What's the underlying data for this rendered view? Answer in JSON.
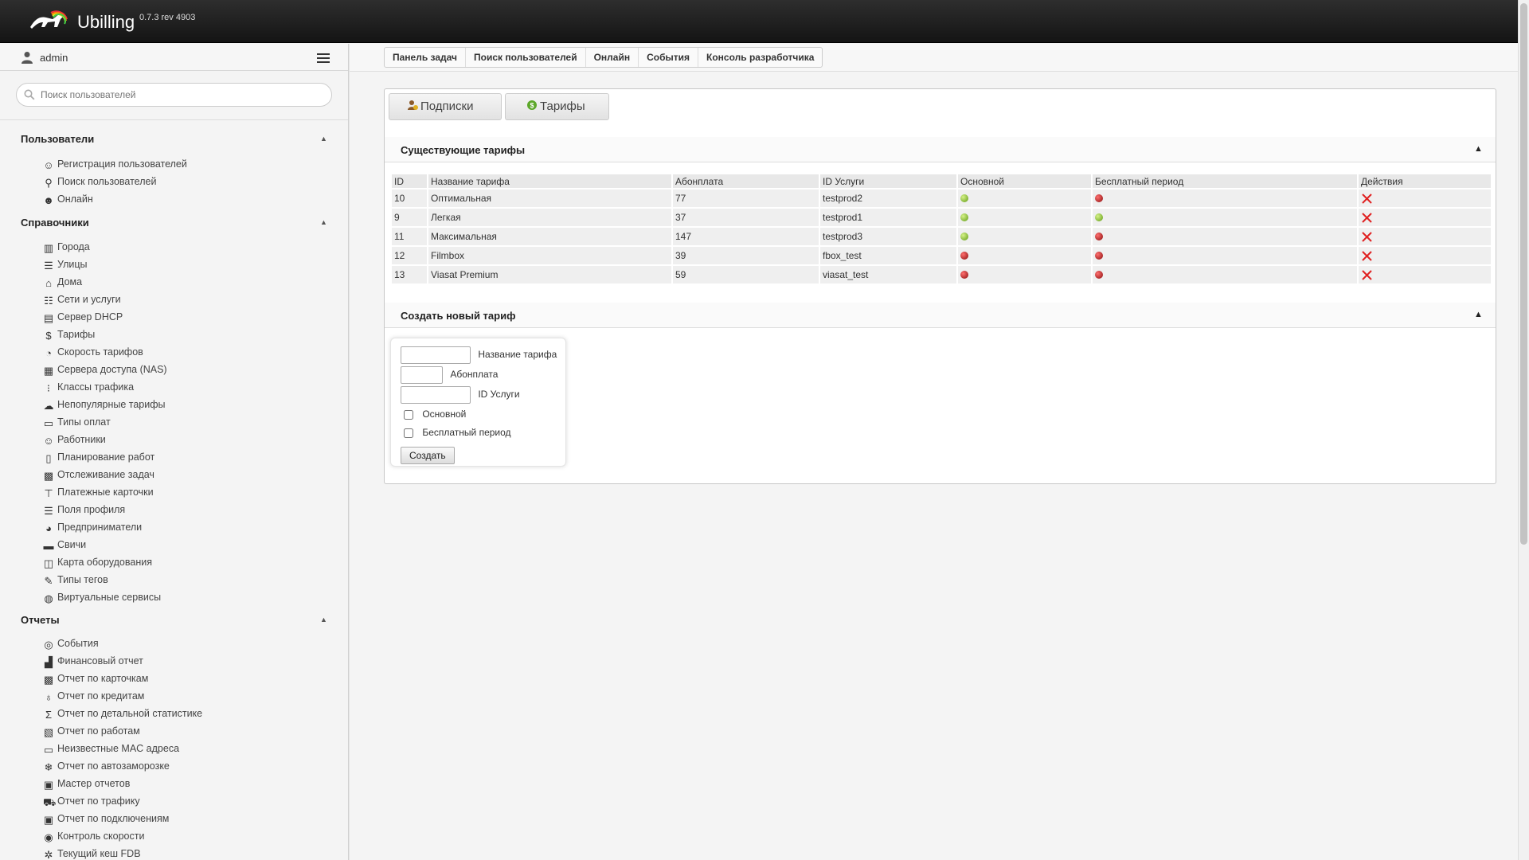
{
  "header": {
    "brand": "Ubilling",
    "version": "0.7.3 rev 4903"
  },
  "user": {
    "name": "admin"
  },
  "search": {
    "placeholder": "Поиск пользователей"
  },
  "sidebar": {
    "sections": [
      {
        "title": "Пользователи",
        "items": [
          {
            "label": "Регистрация пользователей",
            "icon": "user-add-icon"
          },
          {
            "label": "Поиск пользователей",
            "icon": "search-icon"
          },
          {
            "label": "Онлайн",
            "icon": "users-online-icon"
          }
        ]
      },
      {
        "title": "Справочники",
        "items": [
          {
            "label": "Города",
            "icon": "city-icon"
          },
          {
            "label": "Улицы",
            "icon": "street-icon"
          },
          {
            "label": "Дома",
            "icon": "home-icon"
          },
          {
            "label": "Сети и услуги",
            "icon": "network-icon"
          },
          {
            "label": "Сервер DHCP",
            "icon": "server-icon"
          },
          {
            "label": "Тарифы",
            "icon": "dollar-icon"
          },
          {
            "label": "Скорость тарифов",
            "icon": "speedometer-icon"
          },
          {
            "label": "Сервера доступа (NAS)",
            "icon": "nas-icon"
          },
          {
            "label": "Классы трафика",
            "icon": "traffic-icon"
          },
          {
            "label": "Непопулярные тарифы",
            "icon": "unpopular-icon"
          },
          {
            "label": "Типы оплат",
            "icon": "payment-type-icon"
          },
          {
            "label": "Работники",
            "icon": "worker-icon"
          },
          {
            "label": "Планирование работ",
            "icon": "planner-icon"
          },
          {
            "label": "Отслеживание задач",
            "icon": "tasks-icon"
          },
          {
            "label": "Платежные карточки",
            "icon": "card-icon"
          },
          {
            "label": "Поля профиля",
            "icon": "profile-fields-icon"
          },
          {
            "label": "Предприниматели",
            "icon": "pie-icon"
          },
          {
            "label": "Свичи",
            "icon": "switch-icon"
          },
          {
            "label": "Карта оборудования",
            "icon": "map-icon"
          },
          {
            "label": "Типы тегов",
            "icon": "tag-icon"
          },
          {
            "label": "Виртуальные сервисы",
            "icon": "virtual-services-icon"
          }
        ]
      },
      {
        "title": "Отчеты",
        "items": [
          {
            "label": "События",
            "icon": "check-circle-icon"
          },
          {
            "label": "Финансовый отчет",
            "icon": "finance-icon"
          },
          {
            "label": "Отчет по карточкам",
            "icon": "cards-report-icon"
          },
          {
            "label": "Отчет по кредитам",
            "icon": "credit-icon"
          },
          {
            "label": "Отчет по детальной статистике",
            "icon": "sigma-icon"
          },
          {
            "label": "Отчет по работам",
            "icon": "works-icon"
          },
          {
            "label": "Неизвестные MAC адреса",
            "icon": "mac-icon"
          },
          {
            "label": "Отчет по автозаморозке",
            "icon": "freeze-icon"
          },
          {
            "label": "Мастер отчетов",
            "icon": "wizard-icon"
          },
          {
            "label": "Отчет по трафику",
            "icon": "traffic-report-icon"
          },
          {
            "label": "Отчет по подключениям",
            "icon": "connections-icon"
          },
          {
            "label": "Контроль скорости",
            "icon": "speed-control-icon"
          },
          {
            "label": "Текущий кеш FDB",
            "icon": "fdb-icon"
          }
        ]
      }
    ]
  },
  "breadcrumbs": [
    "Панель задач",
    "Поиск пользователей",
    "Онлайн",
    "События",
    "Консоль разработчика"
  ],
  "tabs": {
    "subscriptions": "Подписки",
    "tariffs": "Тарифы"
  },
  "existing": {
    "title": "Существующие тарифы",
    "columns": [
      "ID",
      "Название тарифа",
      "Абонплата",
      "ID Услуги",
      "Основной",
      "Бесплатный период",
      "Действия"
    ],
    "rows": [
      {
        "id": "10",
        "name": "Оптимальная",
        "fee": "77",
        "service_id": "testprod2",
        "main": "green",
        "free": "red"
      },
      {
        "id": "9",
        "name": "Легкая",
        "fee": "37",
        "service_id": "testprod1",
        "main": "green",
        "free": "green"
      },
      {
        "id": "11",
        "name": "Максимальная",
        "fee": "147",
        "service_id": "testprod3",
        "main": "green",
        "free": "red"
      },
      {
        "id": "12",
        "name": "Filmbox",
        "fee": "39",
        "service_id": "fbox_test",
        "main": "red",
        "free": "red"
      },
      {
        "id": "13",
        "name": "Viasat Premium",
        "fee": "59",
        "service_id": "viasat_test",
        "main": "red",
        "free": "red"
      }
    ]
  },
  "create": {
    "title": "Создать новый тариф",
    "name_label": "Название тарифа",
    "fee_label": "Абонплата",
    "service_label": "ID Услуги",
    "main_label": "Основной",
    "free_label": "Бесплатный период",
    "submit": "Создать"
  },
  "colors": {
    "status_on": "#5e9a12",
    "status_off": "#8a0c0c",
    "delete": "#e02020"
  }
}
